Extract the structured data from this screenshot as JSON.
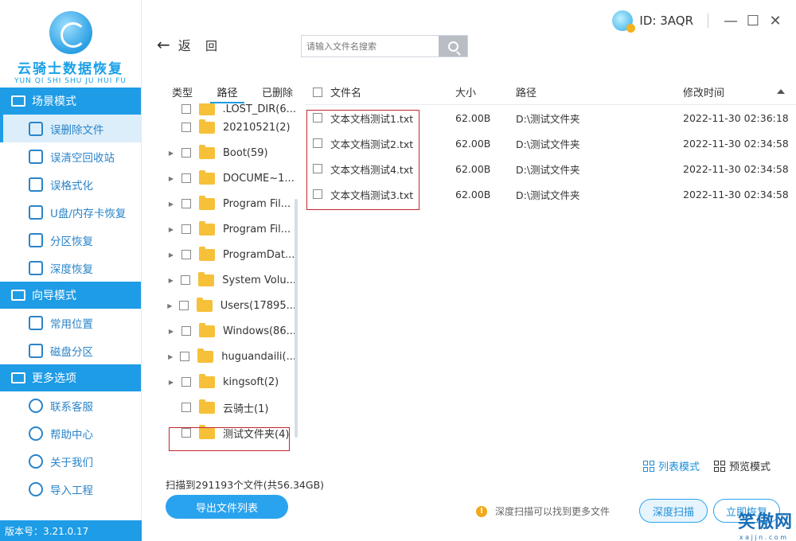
{
  "app": {
    "logo_title": "云骑士数据恢复",
    "logo_subtitle": "YUN QI SHI SHU JU HUI FU",
    "version": "版本号：3.21.0.17",
    "user_id": "ID: 3AQR"
  },
  "sidebar": {
    "sections": [
      {
        "title": "场景模式",
        "icon": "monitor-icon",
        "items": [
          {
            "label": "误删除文件",
            "icon": "file-delete-icon",
            "active": true
          },
          {
            "label": "误清空回收站",
            "icon": "recycle-bin-icon"
          },
          {
            "label": "误格式化",
            "icon": "format-icon"
          },
          {
            "label": "U盘/内存卡恢复",
            "icon": "usb-icon"
          },
          {
            "label": "分区恢复",
            "icon": "partition-icon"
          },
          {
            "label": "深度恢复",
            "icon": "deep-recover-icon"
          }
        ]
      },
      {
        "title": "向导模式",
        "icon": "signpost-icon",
        "items": [
          {
            "label": "常用位置",
            "icon": "windows-icon"
          },
          {
            "label": "磁盘分区",
            "icon": "disk-icon"
          }
        ]
      },
      {
        "title": "更多选项",
        "icon": "menu-icon",
        "items": [
          {
            "label": "联系客服",
            "icon": "phone-icon"
          },
          {
            "label": "帮助中心",
            "icon": "help-icon"
          },
          {
            "label": "关于我们",
            "icon": "info-icon"
          },
          {
            "label": "导入工程",
            "icon": "import-icon"
          }
        ]
      }
    ]
  },
  "toolbar": {
    "back_label": "返",
    "refresh_label": "回",
    "search_placeholder": "请输入文件名搜索"
  },
  "tree": {
    "tabs": [
      "类型",
      "路径",
      "已删除"
    ],
    "active_tab": 1,
    "rows": [
      {
        "label": ".LOST_DIR(6...",
        "caret": false
      },
      {
        "label": "20210521(2)",
        "caret": false
      },
      {
        "label": "Boot(59)",
        "caret": true
      },
      {
        "label": "DOCUME~1...",
        "caret": true
      },
      {
        "label": "Program Fil...",
        "caret": true
      },
      {
        "label": "Program Fil...",
        "caret": true
      },
      {
        "label": "ProgramDat...",
        "caret": true
      },
      {
        "label": "System Volu...",
        "caret": true
      },
      {
        "label": "Users(17895...",
        "caret": true
      },
      {
        "label": "Windows(86...",
        "caret": true
      },
      {
        "label": "huguandaili(...",
        "caret": true
      },
      {
        "label": "kingsoft(2)",
        "caret": true
      },
      {
        "label": "云骑士(1)",
        "caret": false
      },
      {
        "label": "测试文件夹(4)",
        "caret": false
      }
    ]
  },
  "table": {
    "headers": {
      "name": "文件名",
      "size": "大小",
      "path": "路径",
      "time": "修改时间"
    },
    "rows": [
      {
        "name": "文本文档测试1.txt",
        "size": "62.00B",
        "path": "D:\\测试文件夹",
        "time": "2022-11-30 02:36:18"
      },
      {
        "name": "文本文档测试2.txt",
        "size": "62.00B",
        "path": "D:\\测试文件夹",
        "time": "2022-11-30 02:34:58"
      },
      {
        "name": "文本文档测试4.txt",
        "size": "62.00B",
        "path": "D:\\测试文件夹",
        "time": "2022-11-30 02:34:58"
      },
      {
        "name": "文本文档测试3.txt",
        "size": "62.00B",
        "path": "D:\\测试文件夹",
        "time": "2022-11-30 02:34:58"
      }
    ]
  },
  "footer": {
    "list_mode": "列表模式",
    "preview_mode": "预览模式",
    "scan_info": "扫描到291193个文件(共56.34GB)",
    "export_button": "导出文件列表",
    "tip": "深度扫描可以找到更多文件",
    "deep_scan_button": "深度扫描",
    "recover_button": "立即恢复"
  },
  "watermark": {
    "text": "笑傲网",
    "sub": "x a j j n . c o m"
  },
  "colors": {
    "accent": "#1e9ce6",
    "highlight_border": "#c0272d",
    "folder": "#f6c039"
  }
}
